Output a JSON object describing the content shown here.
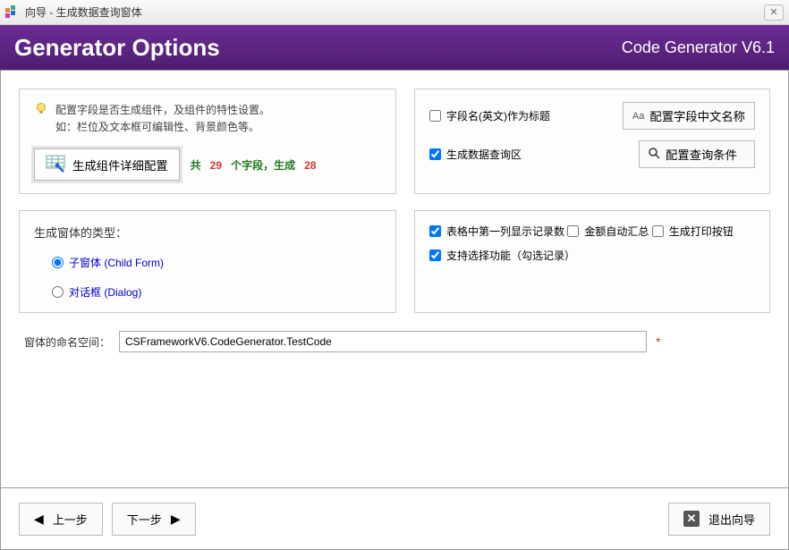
{
  "window": {
    "title": "向导 - 生成数据查询窗体"
  },
  "header": {
    "title": "Generator Options",
    "brand": "Code Generator",
    "version": "V6.1"
  },
  "hint": {
    "line1": "配置字段是否生成组件，及组件的特性设置。",
    "line2": "如：栏位及文本框可编辑性、背景颜色等。"
  },
  "buttons": {
    "config_detail": "生成组件详细配置",
    "config_cn_name": "配置字段中文名称",
    "config_query": "配置查询条件"
  },
  "stats": {
    "prefix": "共",
    "fields_count": "29",
    "middle": "个字段，生成",
    "gen_count": "28"
  },
  "options_right_top": {
    "use_en_title": "字段名(英文)作为标题",
    "gen_query_area": "生成数据查询区"
  },
  "form_type": {
    "title": "生成窗体的类型：",
    "child": "子窗体 (Child Form)",
    "dialog": "对话框 (Dialog)"
  },
  "options_right_bottom": {
    "show_rec_count": "表格中第一列显示记录数",
    "auto_sum": "金额自动汇总",
    "gen_print": "生成打印按钮",
    "support_select": "支持选择功能（勾选记录）"
  },
  "namespace": {
    "label": "窗体的命名空间：",
    "value": "CSFrameworkV6.CodeGenerator.TestCode"
  },
  "footer": {
    "prev": "上一步",
    "next": "下一步",
    "exit": "退出向导"
  }
}
